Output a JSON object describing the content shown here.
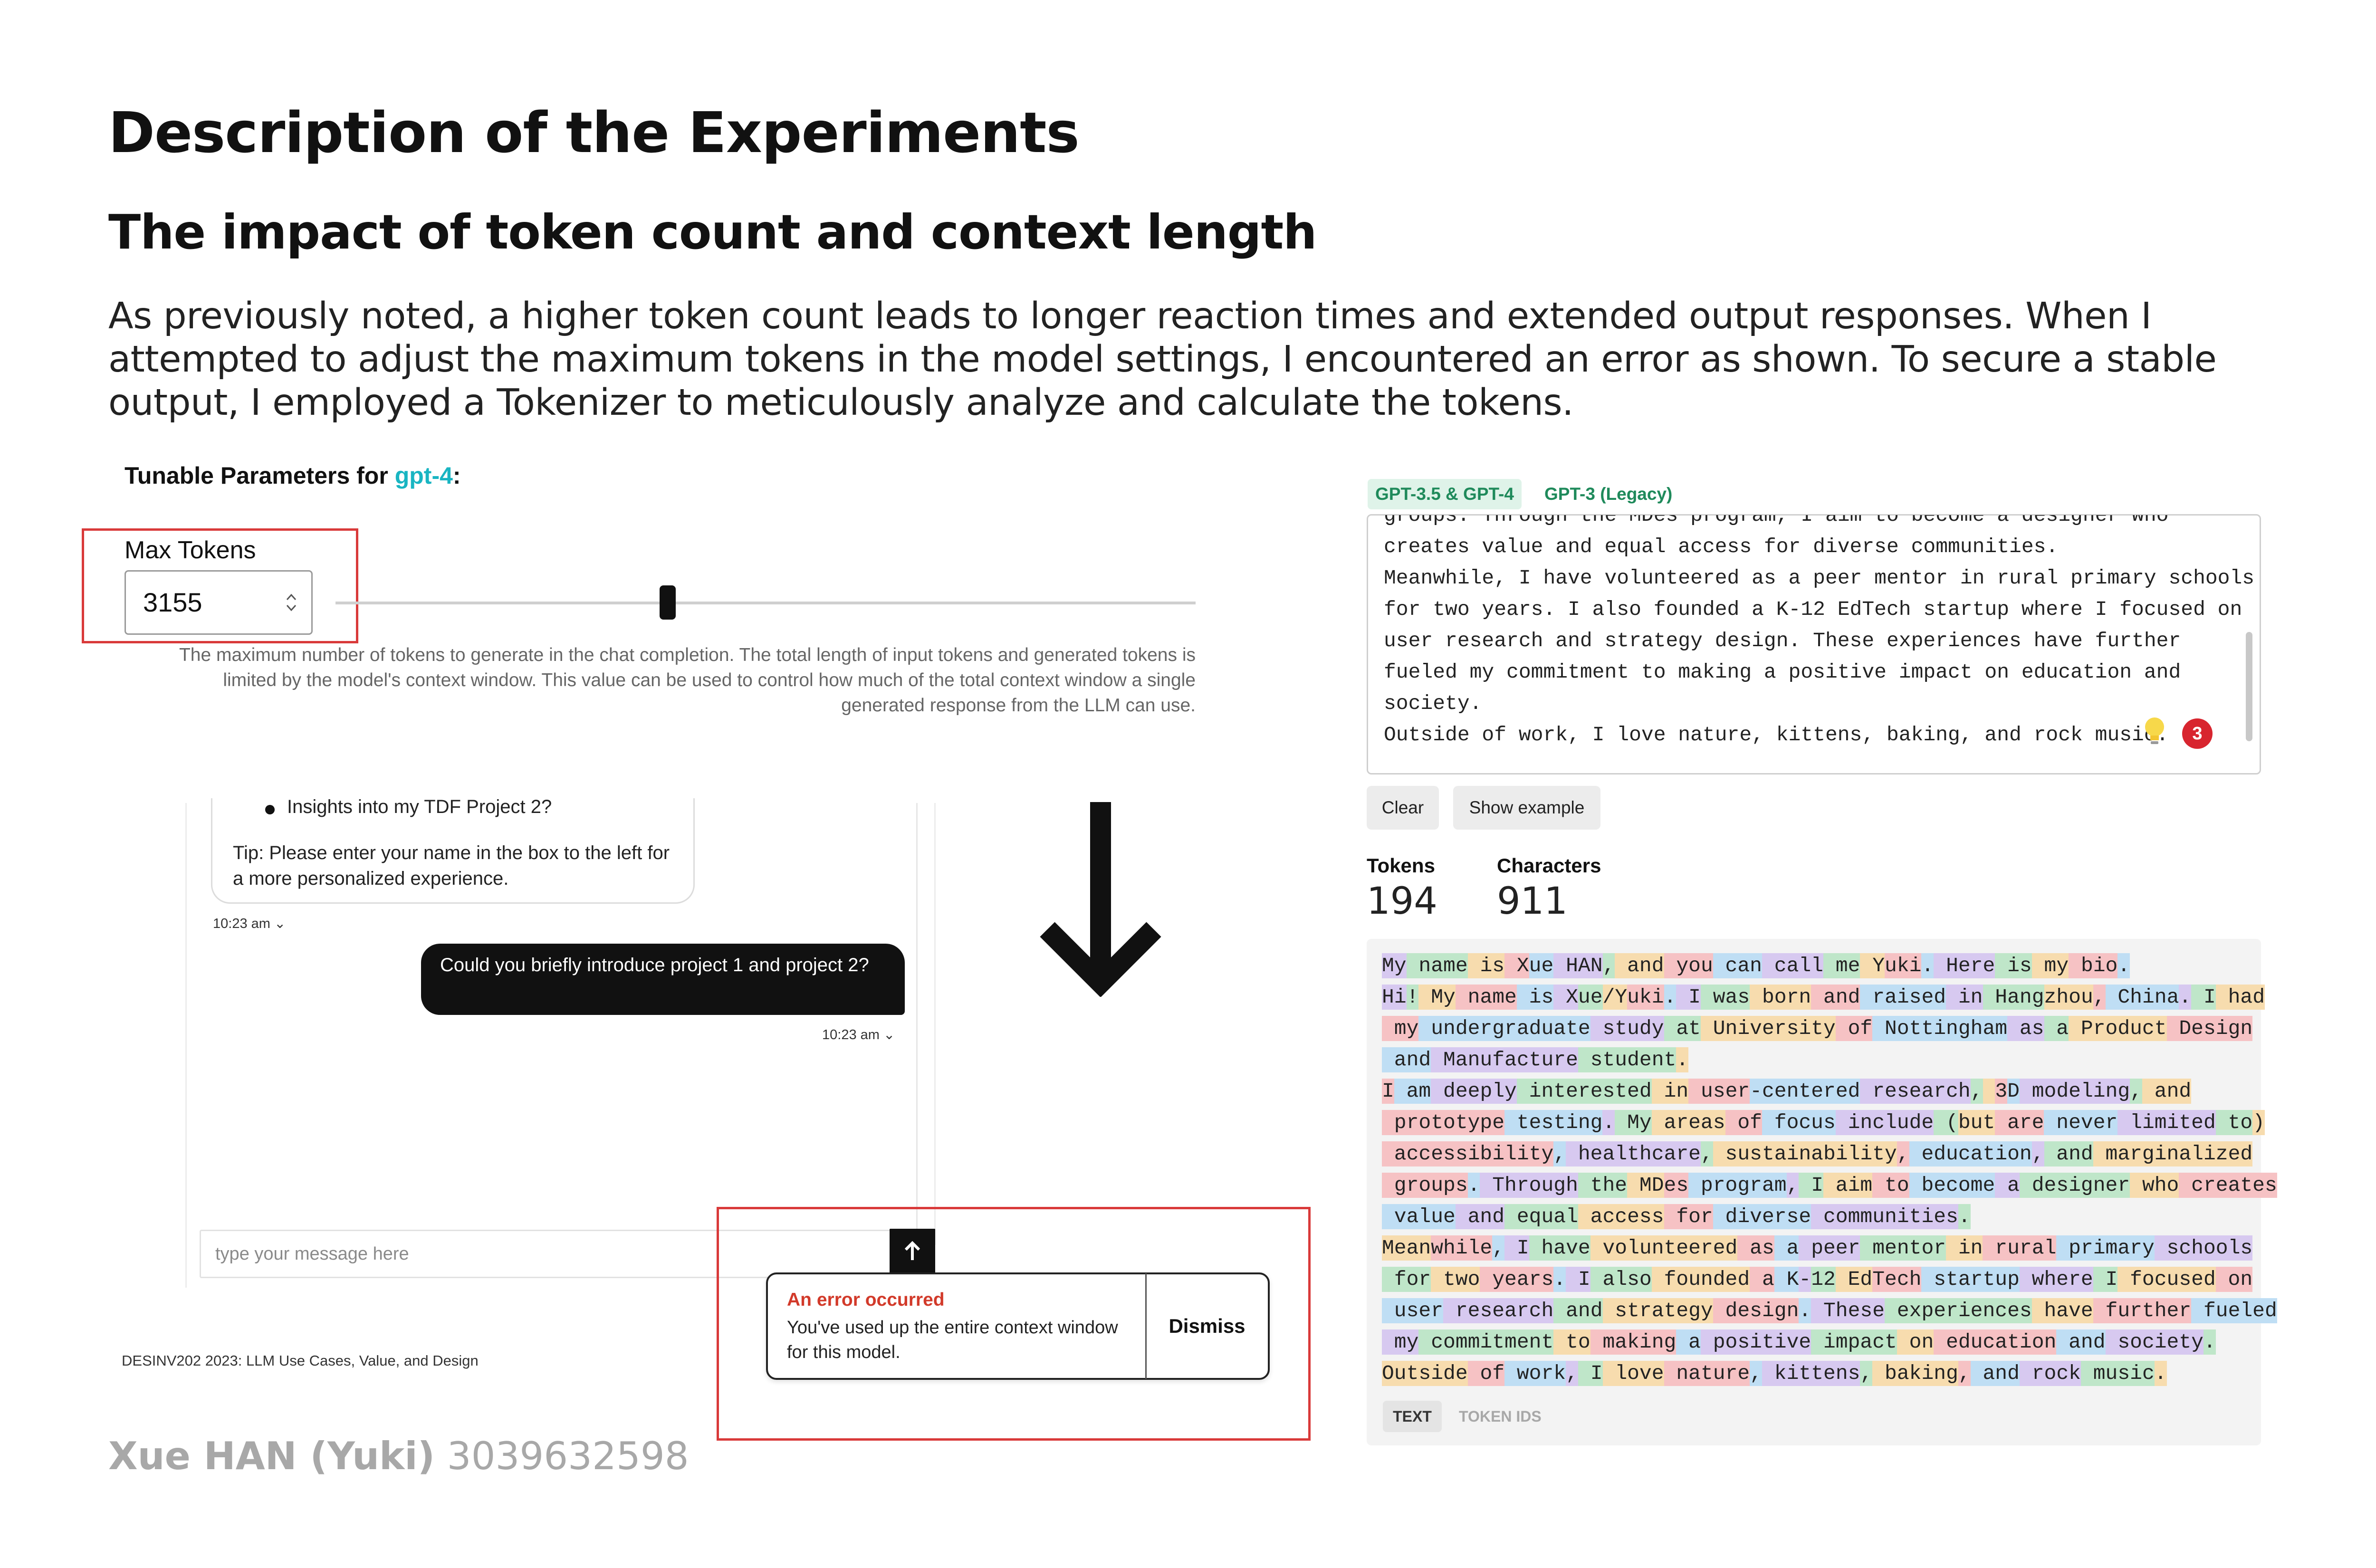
{
  "slide": {
    "title": "Description of the Experiments",
    "subtitle": "The impact of token count and context length",
    "intro": "As previously noted, a higher token count leads to longer reaction times and extended output responses. When I attempted to adjust the maximum tokens in the model settings, I encountered an error as shown. To secure a stable output, I employed a Tokenizer to meticulously analyze and calculate the tokens.",
    "author_name": "Xue HAN (Yuki)",
    "author_id": "3039632598"
  },
  "params": {
    "heading_prefix": "Tunable Parameters for ",
    "model": "gpt-4",
    "heading_suffix": ":",
    "max_tokens_label": "Max Tokens",
    "max_tokens_value": "3155",
    "help": "The maximum number of tokens to generate in the chat completion. The total length of input tokens and generated tokens is limited by the model's context window. This value can be used to control how much of the total context window a single generated response from the LLM can use."
  },
  "chat": {
    "bullet": "Insights into my TDF Project 2?",
    "tip": "Tip: Please enter your name in the box to the left for a more personalized experience.",
    "assistant_time": "10:23 am",
    "user_message": "Could you briefly introduce project 1 and project 2?",
    "user_time": "10:23 am",
    "input_placeholder": "type your message here",
    "course": "DESINV202 2023: LLM Use Cases, Value, and Design"
  },
  "error": {
    "title": "An error occurred",
    "body": "You've used up the entire context window for this model.",
    "dismiss_label": "Dismiss"
  },
  "tokenizer": {
    "tabs": [
      "GPT-3.5 & GPT-4",
      "GPT-3 (Legacy)"
    ],
    "textarea_lines": [
      "groups. Through the MDes program, I aim to become a designer who",
      "creates value and equal access for diverse communities.",
      "Meanwhile, I have volunteered as a peer mentor in rural primary schools",
      "for two years. I also founded a K-12 EdTech startup where I focused on",
      "user research and strategy design. These experiences have further",
      "fueled my commitment to making a positive impact on education and",
      "society.",
      "Outside of work, I love nature, kittens, baking, and rock music."
    ],
    "badge": "3",
    "clear_label": "Clear",
    "show_example_label": "Show example",
    "tokens_label": "Tokens",
    "tokens_value": "194",
    "characters_label": "Characters",
    "characters_value": "911",
    "view_tabs": [
      "TEXT",
      "TOKEN IDS"
    ],
    "token_lines": [
      [
        "My",
        " name",
        " is",
        " X",
        "ue",
        " HAN",
        ",",
        " and",
        " you",
        " can",
        " call",
        " me",
        " Y",
        "uki",
        ".",
        " Here",
        " is",
        " my",
        " bio",
        "."
      ],
      [
        "Hi",
        "!",
        " My",
        " name",
        " is",
        " X",
        "ue",
        "/Y",
        "uki",
        ".",
        " I",
        " was",
        " born",
        " and",
        " raised",
        " in",
        " Hang",
        "zhou",
        ",",
        " China",
        ".",
        " I",
        " had"
      ],
      [
        " my",
        " undergraduate",
        " study",
        " at",
        " University",
        " of",
        " Nottingham",
        " as",
        " a",
        " Product",
        " Design"
      ],
      [
        " and",
        " Manufacture",
        " student",
        "."
      ],
      [
        "I",
        " am",
        " deeply",
        " interested",
        " in",
        " user",
        "-centered",
        " research",
        ",",
        " ",
        "3",
        "D",
        " modeling",
        ",",
        " and"
      ],
      [
        " prototype",
        " testing",
        ".",
        " My",
        " areas",
        " of",
        " focus",
        " include",
        " (",
        "but",
        " are",
        " never",
        " limited",
        " to",
        ")"
      ],
      [
        " accessibility",
        ",",
        " healthcare",
        ",",
        " sustainability",
        ",",
        " education",
        ",",
        " and",
        " marginalized"
      ],
      [
        " groups",
        ".",
        " Through",
        " the",
        " MD",
        "es",
        " program",
        ",",
        " I",
        " aim",
        " to",
        " become",
        " a",
        " designer",
        " who",
        " creates"
      ],
      [
        " value",
        " and",
        " equal",
        " access",
        " for",
        " diverse",
        " communities",
        "."
      ],
      [
        "Mean",
        "while",
        ",",
        " I",
        " have",
        " volunteered",
        " as",
        " a",
        " peer",
        " mentor",
        " in",
        " rural",
        " primary",
        " schools"
      ],
      [
        " for",
        " two",
        " years",
        ".",
        " I",
        " also",
        " founded",
        " a",
        " K",
        "-",
        "12",
        " Ed",
        "Tech",
        " startup",
        " where",
        " I",
        " focused",
        " on"
      ],
      [
        " user",
        " research",
        " and",
        " strategy",
        " design",
        ".",
        " These",
        " experiences",
        " have",
        " further",
        " fueled"
      ],
      [
        " my",
        " commitment",
        " to",
        " making",
        " a",
        " positive",
        " impact",
        " on",
        " education",
        " and",
        " society",
        "."
      ],
      [
        "Outside",
        " of",
        " work",
        ",",
        " I",
        " love",
        " nature",
        ",",
        " kittens",
        ",",
        " baking",
        ",",
        " and",
        " rock",
        " music",
        "."
      ]
    ]
  }
}
